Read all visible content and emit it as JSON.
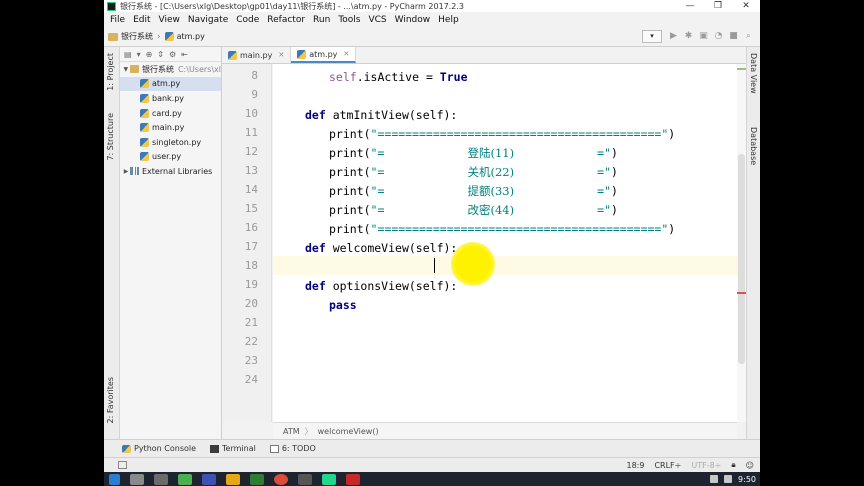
{
  "window": {
    "title": "银行系统 - [C:\\Users\\xlg\\Desktop\\gp01\\day11\\银行系统] - ...\\atm.py - PyCharm 2017.2.3",
    "minimize": "—",
    "maximize": "❐",
    "close": "✕"
  },
  "menu": [
    "File",
    "Edit",
    "View",
    "Navigate",
    "Code",
    "Refactor",
    "Run",
    "Tools",
    "VCS",
    "Window",
    "Help"
  ],
  "navbar": {
    "project": "银行系统",
    "file": "atm.py"
  },
  "left_stripe": {
    "project_tab": "1: Project",
    "structure_tab": "7: Structure",
    "favorites_tab": "2: Favorites"
  },
  "project_tree": {
    "root": "银行系统",
    "root_path": "C:\\Users\\xl",
    "files": [
      "atm.py",
      "bank.py",
      "card.py",
      "main.py",
      "singleton.py",
      "user.py"
    ],
    "external": "External Libraries"
  },
  "editor_tabs": [
    {
      "label": "main.py",
      "active": false
    },
    {
      "label": "atm.py",
      "active": true
    }
  ],
  "line_numbers": [
    "8",
    "9",
    "10",
    "11",
    "12",
    "13",
    "14",
    "15",
    "16",
    "17",
    "18",
    "19",
    "20",
    "21",
    "22",
    "23",
    "24"
  ],
  "code": {
    "l8_self": "self",
    "l8_attr": ".isActive = ",
    "l8_true": "True",
    "l10_def": "def ",
    "l10_name": "atmInitView",
    "l10_args": "(self):",
    "print": "print(",
    "bar_str": "\"=========================================\"",
    "l12_a": "\"=            ",
    "l12_cn": "登陆(11)",
    "l12_b": "            =\"",
    "l13_cn": "关机(22)",
    "l14_cn": "提额(33)",
    "l15_cn": "改密(44)",
    "close": ")",
    "l17_def": "def ",
    "l17_name": "welcomeView",
    "l17_args": "(self):",
    "l19_def": "def ",
    "l19_name": "optionsView",
    "l19_args": "(self):",
    "l20_pass": "pass"
  },
  "breadcrumb": {
    "class": "ATM",
    "sep": "〉",
    "method": "welcomeView()"
  },
  "right_stripe": {
    "sciview": "Data View",
    "database": "Database"
  },
  "bottom_tabs": [
    "Python Console",
    "Terminal",
    "6: TODO"
  ],
  "status": {
    "position": "18:9",
    "line_sep": "CRLF÷",
    "encoding": "UTF-8÷"
  },
  "taskbar": {
    "time": "9:50"
  }
}
